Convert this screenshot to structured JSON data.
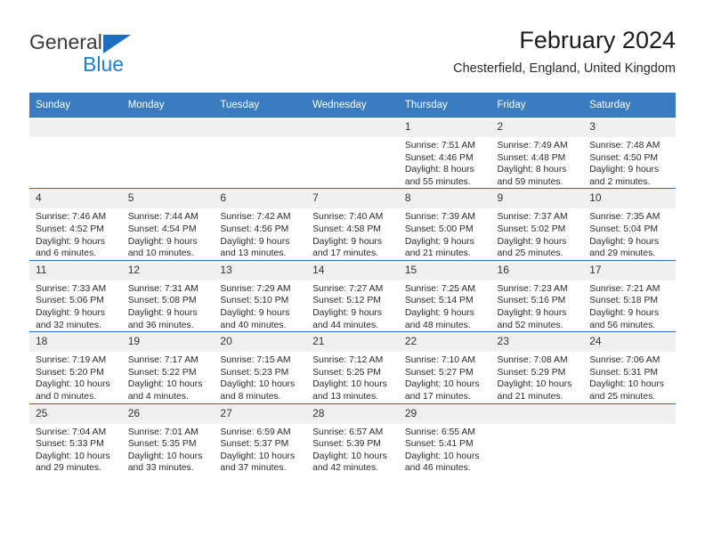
{
  "logo": {
    "primary_text": "General",
    "secondary_text": "Blue",
    "primary_color": "#3a3a3a",
    "secondary_color": "#1b7fd4",
    "triangle_color": "#1b6ec2"
  },
  "header": {
    "title": "February 2024",
    "subtitle": "Chesterfield, England, United Kingdom"
  },
  "theme": {
    "header_row_bg": "#3a7cc0",
    "header_row_text": "#ffffff",
    "row_border": "#2c6fb3",
    "daynum_bg": "#f0f0f0"
  },
  "calendar": {
    "weekday_headers": [
      "Sunday",
      "Monday",
      "Tuesday",
      "Wednesday",
      "Thursday",
      "Friday",
      "Saturday"
    ],
    "labels": {
      "sunrise": "Sunrise:",
      "sunset": "Sunset:",
      "daylight": "Daylight:"
    },
    "weeks": [
      [
        {
          "day": "",
          "empty": true
        },
        {
          "day": "",
          "empty": true
        },
        {
          "day": "",
          "empty": true
        },
        {
          "day": "",
          "empty": true
        },
        {
          "day": "1",
          "sunrise": "Sunrise: 7:51 AM",
          "sunset": "Sunset: 4:46 PM",
          "daylight": "Daylight: 8 hours and 55 minutes."
        },
        {
          "day": "2",
          "sunrise": "Sunrise: 7:49 AM",
          "sunset": "Sunset: 4:48 PM",
          "daylight": "Daylight: 8 hours and 59 minutes."
        },
        {
          "day": "3",
          "sunrise": "Sunrise: 7:48 AM",
          "sunset": "Sunset: 4:50 PM",
          "daylight": "Daylight: 9 hours and 2 minutes."
        }
      ],
      [
        {
          "day": "4",
          "sunrise": "Sunrise: 7:46 AM",
          "sunset": "Sunset: 4:52 PM",
          "daylight": "Daylight: 9 hours and 6 minutes."
        },
        {
          "day": "5",
          "sunrise": "Sunrise: 7:44 AM",
          "sunset": "Sunset: 4:54 PM",
          "daylight": "Daylight: 9 hours and 10 minutes."
        },
        {
          "day": "6",
          "sunrise": "Sunrise: 7:42 AM",
          "sunset": "Sunset: 4:56 PM",
          "daylight": "Daylight: 9 hours and 13 minutes."
        },
        {
          "day": "7",
          "sunrise": "Sunrise: 7:40 AM",
          "sunset": "Sunset: 4:58 PM",
          "daylight": "Daylight: 9 hours and 17 minutes."
        },
        {
          "day": "8",
          "sunrise": "Sunrise: 7:39 AM",
          "sunset": "Sunset: 5:00 PM",
          "daylight": "Daylight: 9 hours and 21 minutes."
        },
        {
          "day": "9",
          "sunrise": "Sunrise: 7:37 AM",
          "sunset": "Sunset: 5:02 PM",
          "daylight": "Daylight: 9 hours and 25 minutes."
        },
        {
          "day": "10",
          "sunrise": "Sunrise: 7:35 AM",
          "sunset": "Sunset: 5:04 PM",
          "daylight": "Daylight: 9 hours and 29 minutes."
        }
      ],
      [
        {
          "day": "11",
          "sunrise": "Sunrise: 7:33 AM",
          "sunset": "Sunset: 5:06 PM",
          "daylight": "Daylight: 9 hours and 32 minutes."
        },
        {
          "day": "12",
          "sunrise": "Sunrise: 7:31 AM",
          "sunset": "Sunset: 5:08 PM",
          "daylight": "Daylight: 9 hours and 36 minutes."
        },
        {
          "day": "13",
          "sunrise": "Sunrise: 7:29 AM",
          "sunset": "Sunset: 5:10 PM",
          "daylight": "Daylight: 9 hours and 40 minutes."
        },
        {
          "day": "14",
          "sunrise": "Sunrise: 7:27 AM",
          "sunset": "Sunset: 5:12 PM",
          "daylight": "Daylight: 9 hours and 44 minutes."
        },
        {
          "day": "15",
          "sunrise": "Sunrise: 7:25 AM",
          "sunset": "Sunset: 5:14 PM",
          "daylight": "Daylight: 9 hours and 48 minutes."
        },
        {
          "day": "16",
          "sunrise": "Sunrise: 7:23 AM",
          "sunset": "Sunset: 5:16 PM",
          "daylight": "Daylight: 9 hours and 52 minutes."
        },
        {
          "day": "17",
          "sunrise": "Sunrise: 7:21 AM",
          "sunset": "Sunset: 5:18 PM",
          "daylight": "Daylight: 9 hours and 56 minutes."
        }
      ],
      [
        {
          "day": "18",
          "sunrise": "Sunrise: 7:19 AM",
          "sunset": "Sunset: 5:20 PM",
          "daylight": "Daylight: 10 hours and 0 minutes."
        },
        {
          "day": "19",
          "sunrise": "Sunrise: 7:17 AM",
          "sunset": "Sunset: 5:22 PM",
          "daylight": "Daylight: 10 hours and 4 minutes."
        },
        {
          "day": "20",
          "sunrise": "Sunrise: 7:15 AM",
          "sunset": "Sunset: 5:23 PM",
          "daylight": "Daylight: 10 hours and 8 minutes."
        },
        {
          "day": "21",
          "sunrise": "Sunrise: 7:12 AM",
          "sunset": "Sunset: 5:25 PM",
          "daylight": "Daylight: 10 hours and 13 minutes."
        },
        {
          "day": "22",
          "sunrise": "Sunrise: 7:10 AM",
          "sunset": "Sunset: 5:27 PM",
          "daylight": "Daylight: 10 hours and 17 minutes."
        },
        {
          "day": "23",
          "sunrise": "Sunrise: 7:08 AM",
          "sunset": "Sunset: 5:29 PM",
          "daylight": "Daylight: 10 hours and 21 minutes."
        },
        {
          "day": "24",
          "sunrise": "Sunrise: 7:06 AM",
          "sunset": "Sunset: 5:31 PM",
          "daylight": "Daylight: 10 hours and 25 minutes."
        }
      ],
      [
        {
          "day": "25",
          "sunrise": "Sunrise: 7:04 AM",
          "sunset": "Sunset: 5:33 PM",
          "daylight": "Daylight: 10 hours and 29 minutes."
        },
        {
          "day": "26",
          "sunrise": "Sunrise: 7:01 AM",
          "sunset": "Sunset: 5:35 PM",
          "daylight": "Daylight: 10 hours and 33 minutes."
        },
        {
          "day": "27",
          "sunrise": "Sunrise: 6:59 AM",
          "sunset": "Sunset: 5:37 PM",
          "daylight": "Daylight: 10 hours and 37 minutes."
        },
        {
          "day": "28",
          "sunrise": "Sunrise: 6:57 AM",
          "sunset": "Sunset: 5:39 PM",
          "daylight": "Daylight: 10 hours and 42 minutes."
        },
        {
          "day": "29",
          "sunrise": "Sunrise: 6:55 AM",
          "sunset": "Sunset: 5:41 PM",
          "daylight": "Daylight: 10 hours and 46 minutes."
        },
        {
          "day": "",
          "empty": true
        },
        {
          "day": "",
          "empty": true
        }
      ]
    ]
  }
}
